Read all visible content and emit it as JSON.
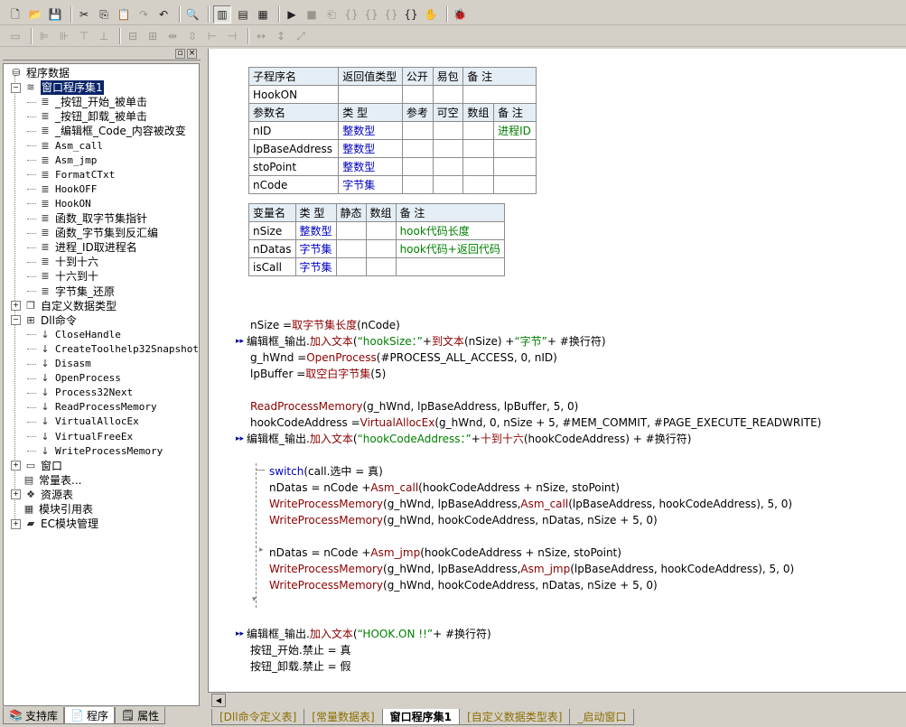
{
  "toolbar1": {
    "icons": [
      "new-file-icon",
      "open-folder-icon",
      "save-icon",
      "cut-icon",
      "copy-icon",
      "paste-icon",
      "redo-icon",
      "undo-icon",
      "find-icon",
      "layout-left-icon",
      "layout-top-icon",
      "layout-split-icon",
      "run-icon",
      "stop-icon",
      "debug-1-icon",
      "debug-2-icon",
      "debug-3-icon",
      "debug-4-icon",
      "debug-5-icon",
      "hand-icon",
      "bug-icon"
    ]
  },
  "sidebar": {
    "tree": [
      {
        "label": "程序数据",
        "level": 0,
        "expander": "",
        "icon": "database-icon",
        "type": "root"
      },
      {
        "label": "窗口程序集1",
        "level": 1,
        "expander": "−",
        "icon": "stack-icon",
        "type": "folder",
        "selected": true
      },
      {
        "label": "_按钮_开始_被单击",
        "level": 2,
        "icon": "sub-icon"
      },
      {
        "label": "_按钮_卸载_被单击",
        "level": 2,
        "icon": "sub-icon"
      },
      {
        "label": "_编辑框_Code_内容被改变",
        "level": 2,
        "icon": "sub-icon"
      },
      {
        "label": "Asm_call",
        "level": 2,
        "icon": "sub-icon",
        "mono": true
      },
      {
        "label": "Asm_jmp",
        "level": 2,
        "icon": "sub-icon",
        "mono": true
      },
      {
        "label": "FormatCTxt",
        "level": 2,
        "icon": "sub-icon",
        "mono": true
      },
      {
        "label": "HookOFF",
        "level": 2,
        "icon": "sub-icon",
        "mono": true
      },
      {
        "label": "HookON",
        "level": 2,
        "icon": "sub-icon",
        "mono": true
      },
      {
        "label": "函数_取字节集指针",
        "level": 2,
        "icon": "sub-icon"
      },
      {
        "label": "函数_字节集到反汇编",
        "level": 2,
        "icon": "sub-icon"
      },
      {
        "label": "进程_ID取进程名",
        "level": 2,
        "icon": "sub-icon"
      },
      {
        "label": "十到十六",
        "level": 2,
        "icon": "sub-icon"
      },
      {
        "label": "十六到十",
        "level": 2,
        "icon": "sub-icon"
      },
      {
        "label": "字节集_还原",
        "level": 2,
        "icon": "sub-icon"
      },
      {
        "label": "自定义数据类型",
        "level": 1,
        "expander": "+",
        "icon": "type-icon"
      },
      {
        "label": "Dll命令",
        "level": 1,
        "expander": "−",
        "icon": "dll-icon"
      },
      {
        "label": "CloseHandle",
        "level": 2,
        "icon": "dll-cmd-icon",
        "mono": true
      },
      {
        "label": "CreateToolhelp32Snapshot",
        "level": 2,
        "icon": "dll-cmd-icon",
        "mono": true
      },
      {
        "label": "Disasm",
        "level": 2,
        "icon": "dll-cmd-icon",
        "mono": true
      },
      {
        "label": "OpenProcess",
        "level": 2,
        "icon": "dll-cmd-icon",
        "mono": true
      },
      {
        "label": "Process32Next",
        "level": 2,
        "icon": "dll-cmd-icon",
        "mono": true
      },
      {
        "label": "ReadProcessMemory",
        "level": 2,
        "icon": "dll-cmd-icon",
        "mono": true
      },
      {
        "label": "VirtualAllocEx",
        "level": 2,
        "icon": "dll-cmd-icon",
        "mono": true
      },
      {
        "label": "VirtualFreeEx",
        "level": 2,
        "icon": "dll-cmd-icon",
        "mono": true
      },
      {
        "label": "WriteProcessMemory",
        "level": 2,
        "icon": "dll-cmd-icon",
        "mono": true
      },
      {
        "label": "窗口",
        "level": 1,
        "expander": "+",
        "icon": "window-icon"
      },
      {
        "label": "常量表...",
        "level": 1,
        "expander": "",
        "icon": "constant-icon"
      },
      {
        "label": "资源表",
        "level": 1,
        "expander": "+",
        "icon": "resource-icon"
      },
      {
        "label": "模块引用表",
        "level": 1,
        "expander": "",
        "icon": "module-icon"
      },
      {
        "label": "EC模块管理",
        "level": 1,
        "expander": "+",
        "icon": "ec-folder-icon"
      }
    ],
    "tabs": [
      {
        "label": "支持库",
        "icon": "library-icon"
      },
      {
        "label": "程序",
        "icon": "program-icon",
        "active": true
      },
      {
        "label": "属性",
        "icon": "properties-icon"
      }
    ]
  },
  "sub_table": {
    "headers": [
      "子程序名",
      "返回值类型",
      "公开",
      "易包",
      "备 注"
    ],
    "row": [
      "HookON",
      "",
      "",
      "",
      ""
    ],
    "param_headers": [
      "参数名",
      "类 型",
      "参考",
      "可空",
      "数组",
      "备 注"
    ],
    "params": [
      [
        "nID",
        "整数型",
        "",
        "",
        "",
        "进程ID"
      ],
      [
        "lpBaseAddress",
        "整数型",
        "",
        "",
        "",
        ""
      ],
      [
        "stoPoint",
        "整数型",
        "",
        "",
        "",
        ""
      ],
      [
        "nCode",
        "字节集",
        "",
        "",
        "",
        ""
      ]
    ]
  },
  "var_table": {
    "headers": [
      "变量名",
      "类 型",
      "静态",
      "数组",
      "备 注"
    ],
    "rows": [
      [
        "nSize",
        "整数型",
        "",
        "",
        "hook代码长度"
      ],
      [
        "nDatas",
        "字节集",
        "",
        "",
        "hook代码+返回代码"
      ],
      [
        "isCall",
        "字节集",
        "",
        "",
        ""
      ]
    ]
  },
  "code": {
    "l1": {
      "a": "nSize = ",
      "f": "取字节集长度",
      "b": " (nCode)"
    },
    "l2": {
      "a": "编辑框_输出.",
      "f": "加入文本",
      "b": " (",
      "s": "“hookSize：”",
      "c": " + ",
      "f2": "到文本",
      "d": " (nSize) + ",
      "s2": "“字节”",
      "e": " + #换行符)"
    },
    "l3": {
      "a": "g_hWnd = ",
      "f": "OpenProcess",
      "b": " (#PROCESS_ALL_ACCESS, 0, nID)"
    },
    "l4": {
      "a": "lpBuffer = ",
      "f": "取空白字节集",
      "b": " (5)"
    },
    "l5": {
      "f": "ReadProcessMemory",
      "b": " (g_hWnd, lpBaseAddress, lpBuffer, 5, 0)"
    },
    "l6": {
      "a": "hookCodeAddress = ",
      "f": "VirtualAllocEx",
      "b": " (g_hWnd, 0, nSize + 5, #MEM_COMMIT, #PAGE_EXECUTE_READWRITE)"
    },
    "l7": {
      "a": "编辑框_输出.",
      "f": "加入文本",
      "b": " (",
      "s": "“hookCodeAddress：”",
      "c": " + ",
      "f2": "十到十六",
      "d": " (hookCodeAddress) + #换行符)"
    },
    "l8": {
      "k": "switch",
      "b": " (call.选中 = 真)"
    },
    "l9": {
      "a": "nDatas = nCode + ",
      "f": "Asm_call",
      "b": " (hookCodeAddress + nSize, stoPoint)"
    },
    "l10": {
      "f": "WriteProcessMemory",
      "b": " (g_hWnd, lpBaseAddress, ",
      "f2": "Asm_call",
      "d": " (lpBaseAddress, hookCodeAddress), 5, 0)"
    },
    "l11": {
      "f": "WriteProcessMemory",
      "b": " (g_hWnd, hookCodeAddress, nDatas, nSize + 5, 0)"
    },
    "l12": {
      "a": "nDatas = nCode + ",
      "f": "Asm_jmp",
      "b": " (hookCodeAddress + nSize, stoPoint)"
    },
    "l13": {
      "f": "WriteProcessMemory",
      "b": " (g_hWnd, lpBaseAddress, ",
      "f2": "Asm_jmp",
      "d": " (lpBaseAddress, hookCodeAddress), 5, 0)"
    },
    "l14": {
      "f": "WriteProcessMemory",
      "b": " (g_hWnd, hookCodeAddress, nDatas, nSize + 5, 0)"
    },
    "l15": {
      "a": "编辑框_输出.",
      "f": "加入文本",
      "b": " (",
      "s": "“HOOK.ON !!”",
      "e": " + #换行符)"
    },
    "l16": {
      "a": "按钮_开始.禁止 = 真"
    },
    "l17": {
      "a": "按钮_卸载.禁止 = 假"
    }
  },
  "editor_tabs": [
    {
      "label": "[Dll命令定义表]"
    },
    {
      "label": "[常量数据表]"
    },
    {
      "label": "窗口程序集1",
      "active": true
    },
    {
      "label": "[自定义数据类型表]"
    },
    {
      "label": "_启动窗口"
    }
  ],
  "colors": {
    "selection": "#0a246a",
    "function": "#8b0000",
    "string": "#008000",
    "keyword": "#0000c0",
    "type": "#0000c0",
    "header": "#e6eef5"
  }
}
